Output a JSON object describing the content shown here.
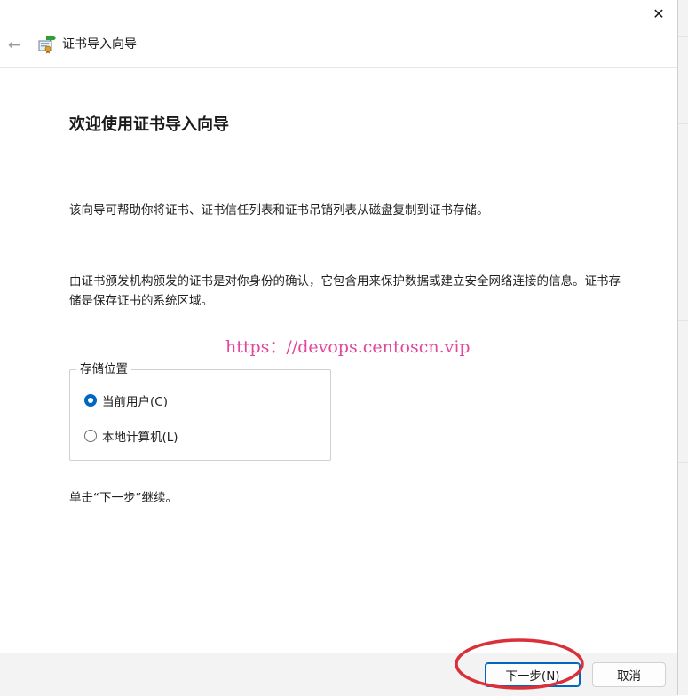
{
  "window": {
    "close_glyph": "✕",
    "back_glyph": "←",
    "title": "证书导入向导"
  },
  "content": {
    "heading": "欢迎使用证书导入向导",
    "paragraph1": "该向导可帮助你将证书、证书信任列表和证书吊销列表从磁盘复制到证书存储。",
    "paragraph2": "由证书颁发机构颁发的证书是对你身份的确认，它包含用来保护数据或建立安全网络连接的信息。证书存储是保存证书的系统区域。",
    "watermark": "https：//devops.centoscn.vip",
    "store_location": {
      "legend": "存储位置",
      "options": [
        {
          "label": "当前用户(C)",
          "selected": true
        },
        {
          "label": "本地计算机(L)",
          "selected": false
        }
      ]
    },
    "instruction": "单击“下一步”继续。"
  },
  "footer": {
    "next_label": "下一步(N)",
    "cancel_label": "取消"
  },
  "colors": {
    "accent": "#0067c0",
    "watermark": "#e0479d",
    "annotation": "#d9303a",
    "footer_bg": "#f3f3f3"
  },
  "icons": {
    "close": "close-icon",
    "back": "back-arrow-icon",
    "wizard": "certificate-wizard-icon"
  }
}
